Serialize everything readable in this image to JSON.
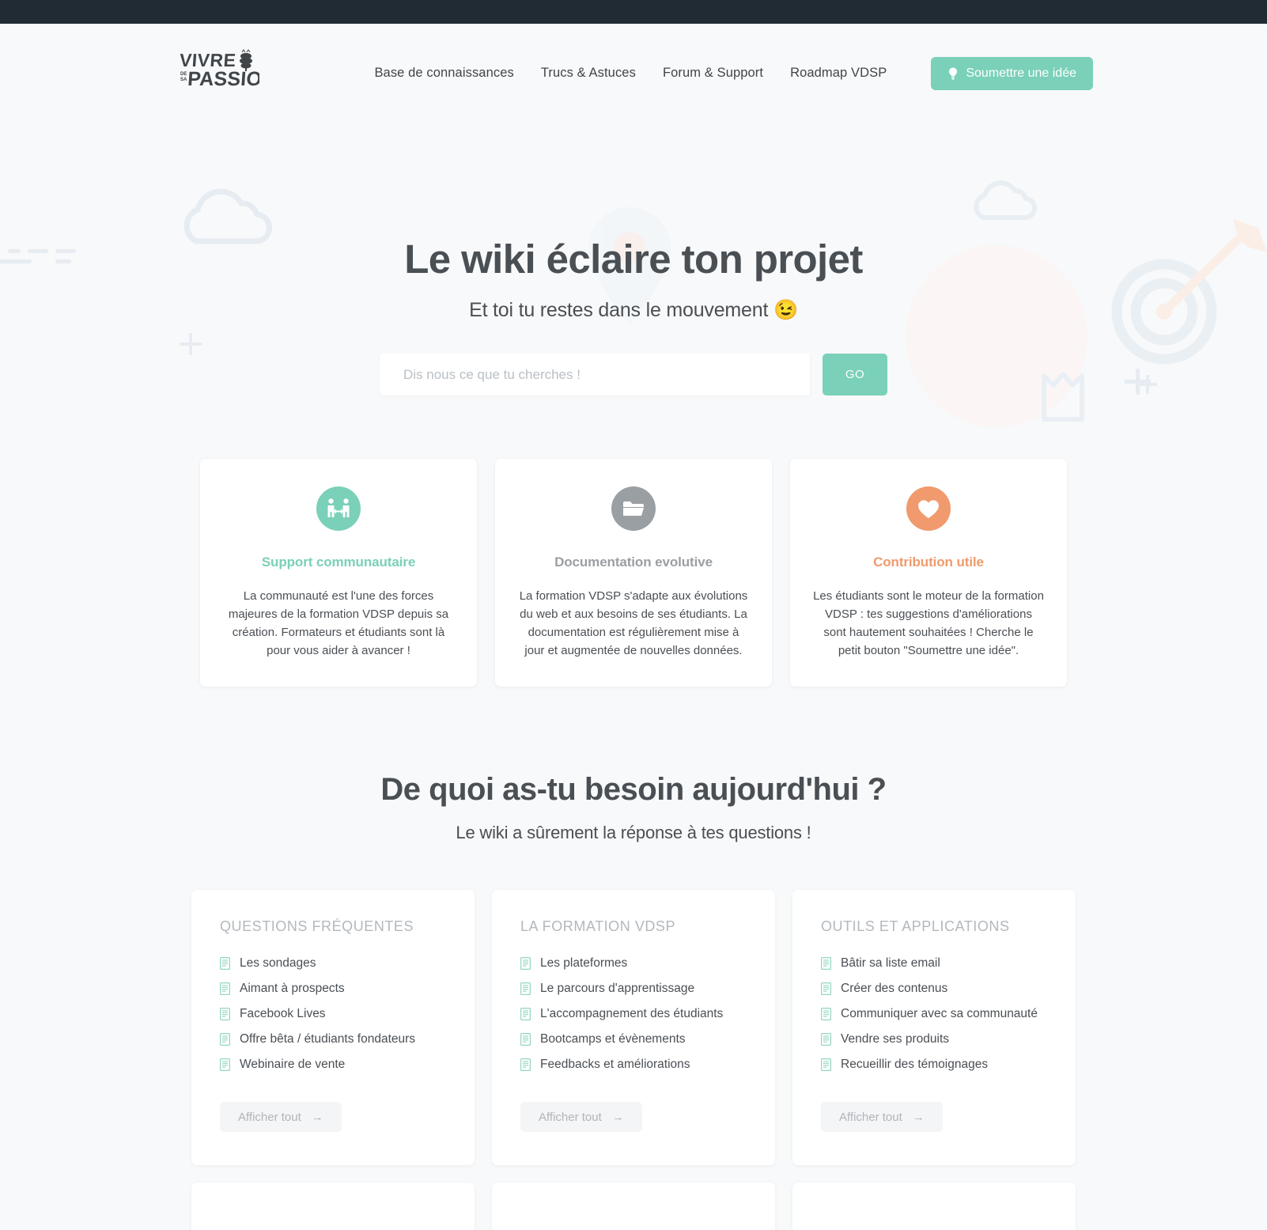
{
  "topbar": {
    "present": true,
    "color": "#212b33"
  },
  "header": {
    "logo_line1": "VIVRE",
    "logo_line2": "DE SA",
    "logo_line3": "PASSION",
    "nav": [
      {
        "label": "Base de connaissances"
      },
      {
        "label": "Trucs & Astuces"
      },
      {
        "label": "Forum & Support"
      },
      {
        "label": "Roadmap VDSP"
      }
    ],
    "submit_button": {
      "label": "Soumettre une idée",
      "icon": "lightbulb-icon",
      "color": "#7ad0b8"
    }
  },
  "hero": {
    "title": "Le wiki éclaire ton projet",
    "subtitle": "Et toi tu restes dans le mouvement 😉",
    "search": {
      "placeholder": "Dis nous ce que tu cherches !",
      "value": "",
      "button_label": "GO"
    }
  },
  "features": [
    {
      "icon": "people-handshake-icon",
      "color": "#7ad0b8",
      "title": "Support communautaire",
      "text": "La communauté est l'une des forces majeures de la formation VDSP depuis sa création. Formateurs et étudiants sont là pour vous aider à avancer !"
    },
    {
      "icon": "folder-icon",
      "color": "#9a9fa3",
      "title": "Documentation evolutive",
      "text": "La formation VDSP s'adapte aux évolutions du web et aux besoins de ses étudiants. La documentation est régulièrement mise à jour et augmentée de nouvelles données."
    },
    {
      "icon": "heart-icon",
      "color": "#f09a6d",
      "title": "Contribution utile",
      "text": "Les étudiants sont le moteur de la formation VDSP : tes suggestions d'améliorations sont hautement souhaitées ! Cherche le petit bouton \"Soumettre une idée\"."
    }
  ],
  "section2": {
    "title": "De quoi as-tu besoin aujourd'hui ?",
    "subtitle": "Le wiki a sûrement la réponse à tes questions !",
    "show_all_label": "Afficher tout",
    "categories": [
      {
        "title": "QUESTIONS FRÉQUENTES",
        "items": [
          "Les sondages",
          "Aimant à prospects",
          "Facebook Lives",
          "Offre bêta / étudiants fondateurs",
          "Webinaire de vente"
        ]
      },
      {
        "title": "LA FORMATION VDSP",
        "items": [
          "Les plateformes",
          "Le parcours d'apprentissage",
          "L'accompagnement des étudiants",
          "Bootcamps et évènements",
          "Feedbacks et améliorations"
        ]
      },
      {
        "title": "OUTILS ET APPLICATIONS",
        "items": [
          "Bâtir sa liste email",
          "Créer des contenus",
          "Communiquer avec sa communauté",
          "Vendre ses produits",
          "Recueillir des témoignages"
        ]
      }
    ]
  }
}
